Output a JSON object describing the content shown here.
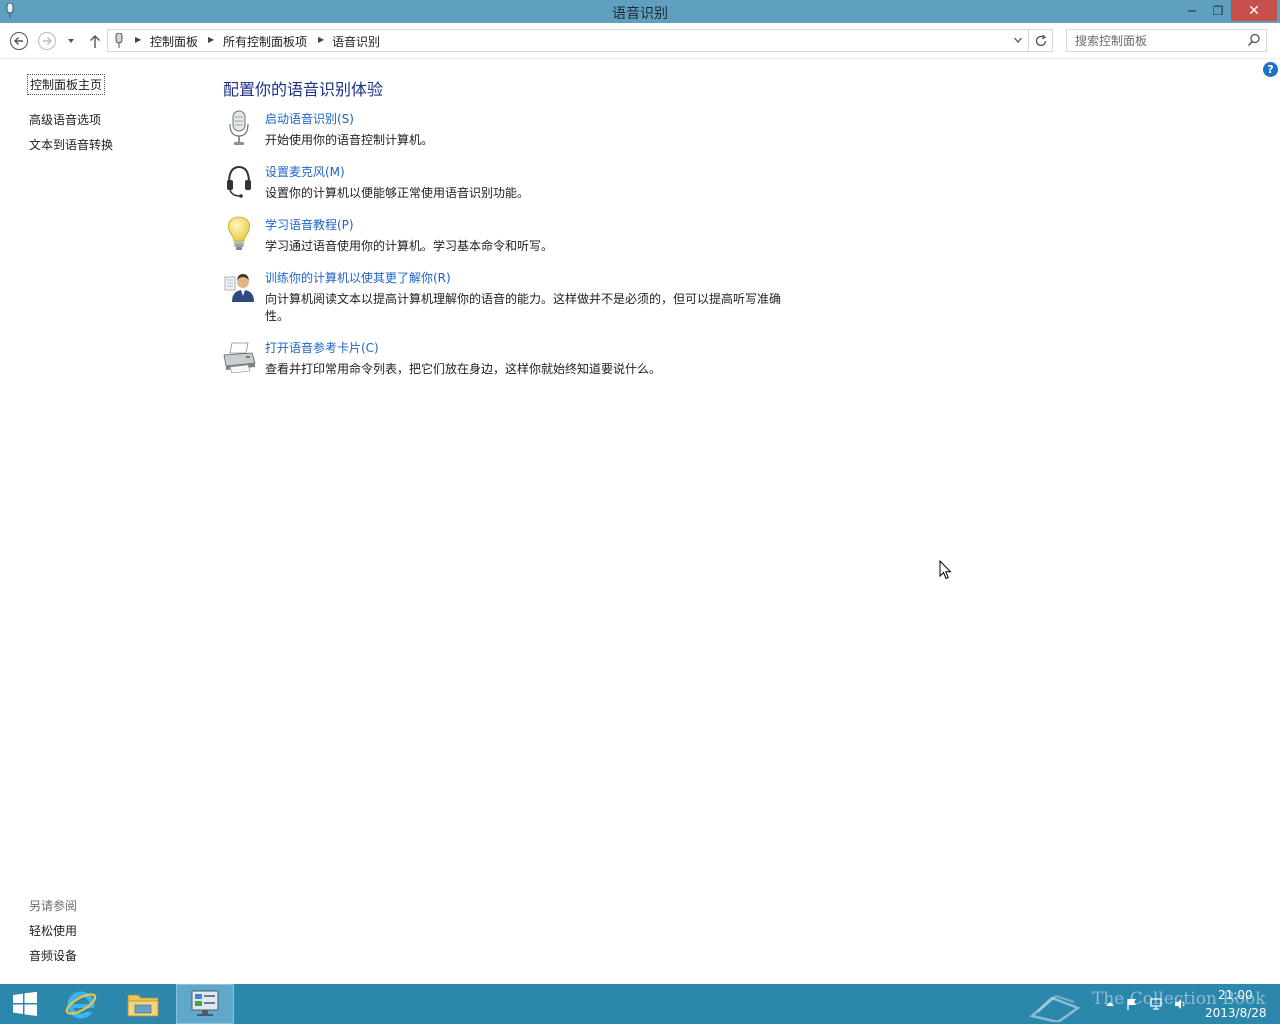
{
  "window": {
    "title": "语音识别",
    "minimize": "─",
    "maximize": "❐",
    "close": "✕"
  },
  "address": {
    "crumbs": [
      "控制面板",
      "所有控制面板项",
      "语音识别"
    ]
  },
  "search": {
    "placeholder": "搜索控制面板"
  },
  "help": {
    "label": "?"
  },
  "sidebar": {
    "home": "控制面板主页",
    "links": [
      "高级语音选项",
      "文本到语音转换"
    ],
    "see_also_heading": "另请参阅",
    "see_also": [
      "轻松使用",
      "音频设备"
    ]
  },
  "main": {
    "heading": "配置你的语音识别体验",
    "tasks": [
      {
        "icon": "microphone-icon",
        "link": "启动语音识别(S)",
        "desc": "开始使用你的语音控制计算机。"
      },
      {
        "icon": "headset-icon",
        "link": "设置麦克风(M)",
        "desc": "设置你的计算机以便能够正常使用语音识别功能。"
      },
      {
        "icon": "lightbulb-icon",
        "link": "学习语音教程(P)",
        "desc": "学习通过语音使用你的计算机。学习基本命令和听写。"
      },
      {
        "icon": "user-training-icon",
        "link": "训练你的计算机以使其更了解你(R)",
        "desc": "向计算机阅读文本以提高计算机理解你的语音的能力。这样做并不是必须的，但可以提高听写准确性。"
      },
      {
        "icon": "printer-icon",
        "link": "打开语音参考卡片(C)",
        "desc": "查看并打印常用命令列表，把它们放在身边，这样你就始终知道要说什么。"
      }
    ]
  },
  "taskbar": {
    "watermark": "The Collection Book",
    "time": "21:00",
    "date": "2013/8/28"
  },
  "colors": {
    "titlebar": "#5fa0c0",
    "taskbar": "#2c87ad",
    "link": "#1e64c8",
    "heading": "#1e3287",
    "close": "#c7504b"
  }
}
